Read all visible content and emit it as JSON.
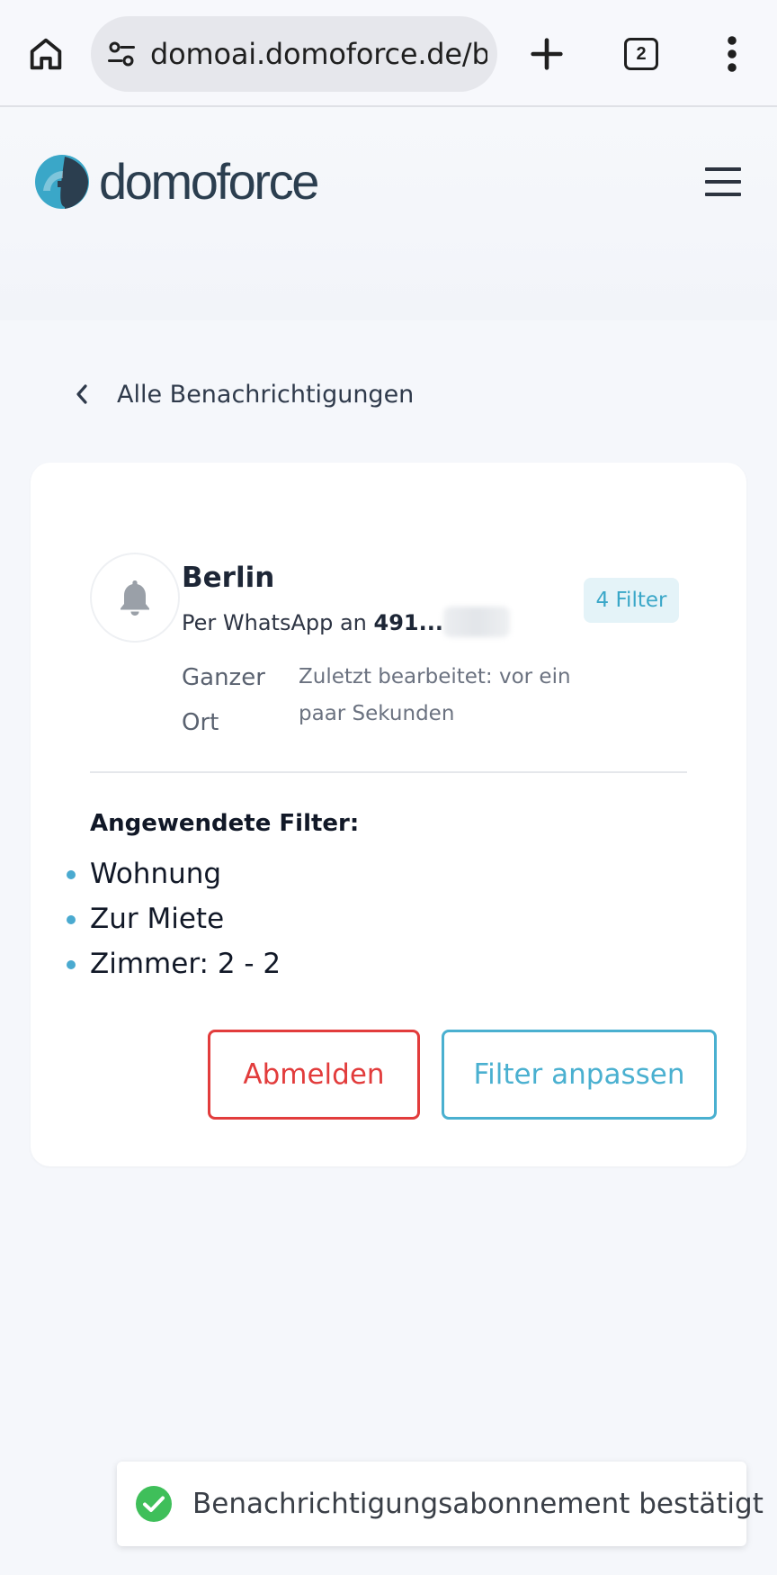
{
  "browser": {
    "url": "domoai.domoforce.de/b",
    "tab_count": "2",
    "icons": [
      "home-icon",
      "site-settings-icon",
      "new-tab-icon",
      "tab-switcher-icon",
      "more-menu-icon"
    ]
  },
  "header": {
    "logo_text": "domoforce",
    "brand_colors": {
      "primary": "#2b3e4f",
      "accent": "#3aa7c8"
    }
  },
  "nav": {
    "back_label": "Alle Benachrichtigungen"
  },
  "subscription": {
    "title": "Berlin",
    "channel_prefix": "Per WhatsApp an",
    "phone_visible": "491...",
    "filter_count_label": "4 Filter",
    "scope": "Ganzer Ort",
    "edited": "Zuletzt bearbeitet: vor ein paar Sekunden",
    "applied_filters_heading": "Angewendete Filter:",
    "applied_filters": [
      "Wohnung",
      "Zur Miete",
      "Zimmer: 2 - 2"
    ],
    "unsubscribe_label": "Abmelden",
    "edit_filters_label": "Filter anpassen",
    "colors": {
      "danger": "#e23c3c",
      "primary": "#4ab0d0"
    }
  },
  "toast": {
    "message": "Benachrichtigungsabonnement bestätigt",
    "status_color": "#3fbf5a"
  }
}
